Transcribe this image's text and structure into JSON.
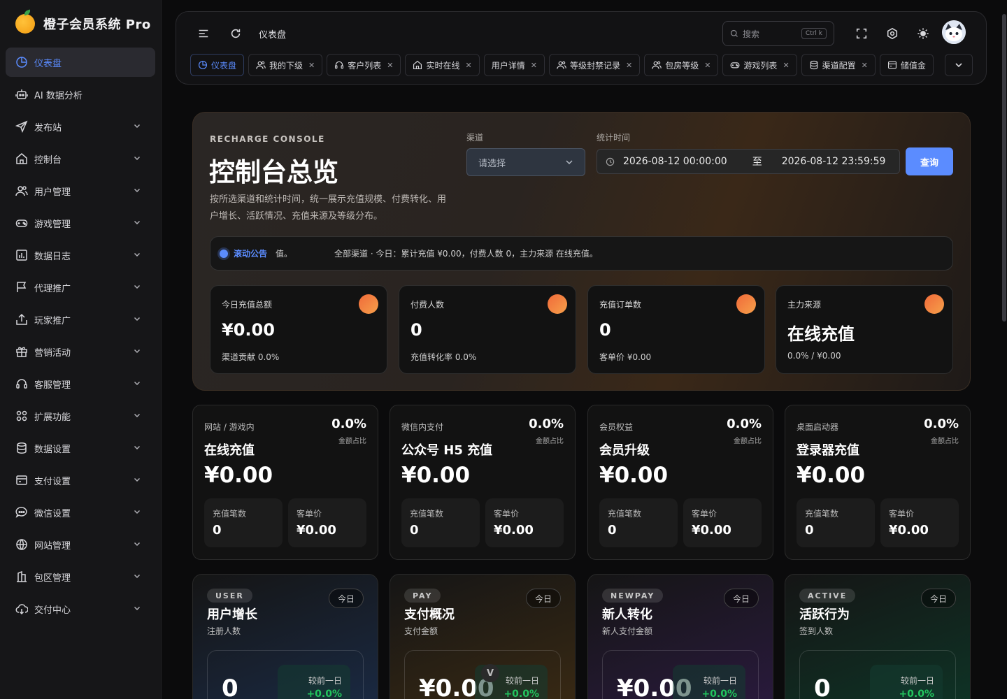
{
  "brand": {
    "name": "橙子会员系统 Pro"
  },
  "sidebar": {
    "items": [
      {
        "label": "仪表盘",
        "icon": "dashboard-icon",
        "active": true
      },
      {
        "label": "AI 数据分析",
        "icon": "robot-icon"
      },
      {
        "label": "发布站",
        "icon": "send-icon",
        "expandable": true
      },
      {
        "label": "控制台",
        "icon": "home-icon",
        "expandable": true
      },
      {
        "label": "用户管理",
        "icon": "users-icon",
        "expandable": true
      },
      {
        "label": "游戏管理",
        "icon": "gamepad-icon",
        "expandable": true
      },
      {
        "label": "数据日志",
        "icon": "chart-log-icon",
        "expandable": true
      },
      {
        "label": "代理推广",
        "icon": "flag-icon",
        "expandable": true
      },
      {
        "label": "玩家推广",
        "icon": "share-icon",
        "expandable": true
      },
      {
        "label": "营销活动",
        "icon": "gift-icon",
        "expandable": true
      },
      {
        "label": "客服管理",
        "icon": "headset-icon",
        "expandable": true
      },
      {
        "label": "扩展功能",
        "icon": "apps-icon",
        "expandable": true
      },
      {
        "label": "数据设置",
        "icon": "database-icon",
        "expandable": true
      },
      {
        "label": "支付设置",
        "icon": "wallet-icon",
        "expandable": true
      },
      {
        "label": "微信设置",
        "icon": "chat-icon",
        "expandable": true
      },
      {
        "label": "网站管理",
        "icon": "globe-icon",
        "expandable": true
      },
      {
        "label": "包区管理",
        "icon": "building-icon",
        "expandable": true
      },
      {
        "label": "交付中心",
        "icon": "cloud-icon",
        "expandable": true
      }
    ]
  },
  "header": {
    "title": "仪表盘",
    "search": {
      "placeholder": "搜索",
      "shortcut": "Ctrl k"
    }
  },
  "tabs": [
    {
      "label": "仪表盘",
      "icon": "dashboard-icon",
      "active": true,
      "closable": false
    },
    {
      "label": "我的下级",
      "icon": "users-icon",
      "closable": true
    },
    {
      "label": "客户列表",
      "icon": "headset-icon",
      "closable": true
    },
    {
      "label": "实时在线",
      "icon": "home-icon",
      "closable": true
    },
    {
      "label": "用户详情",
      "icon": "",
      "closable": true
    },
    {
      "label": "等级封禁记录",
      "icon": "users-icon",
      "closable": true
    },
    {
      "label": "包房等级",
      "icon": "users-icon",
      "closable": true
    },
    {
      "label": "游戏列表",
      "icon": "gamepad-icon",
      "closable": true
    },
    {
      "label": "渠道配置",
      "icon": "database-icon",
      "closable": true
    },
    {
      "label": "储值金",
      "icon": "wallet-icon",
      "closable": false
    }
  ],
  "hero": {
    "eyebrow": "RECHARGE CONSOLE",
    "title": "控制台总览",
    "description": "按所选渠道和统计时间，统一展示充值规模、付费转化、用户增长、活跃情况、充值来源及等级分布。",
    "channel_label": "渠道",
    "channel_placeholder": "请选择",
    "time_label": "统计时间",
    "date_start": "2026-08-12 00:00:00",
    "date_sep": "至",
    "date_end": "2026-08-12 23:59:59",
    "query_label": "查询",
    "notice_tag": "滚动公告",
    "notice_prefix": "值。",
    "notice_text": "全部渠道 · 今日：累计充值 ¥0.00，付费人数 0，主力来源 在线充值。"
  },
  "stats": [
    {
      "label": "今日充值总额",
      "value": "¥0.00",
      "sub": "渠道贡献 0.0%"
    },
    {
      "label": "付费人数",
      "value": "0",
      "sub": "充值转化率 0.0%"
    },
    {
      "label": "充值订单数",
      "value": "0",
      "sub": "客单价 ¥0.00"
    },
    {
      "label": "主力来源",
      "value": "在线充值",
      "sub": "0.0% / ¥0.00"
    }
  ],
  "sources": [
    {
      "kicker": "网站 / 游戏内",
      "title": "在线充值",
      "pct": "0.0%",
      "pct_label": "金额占比",
      "amount": "¥0.00",
      "count_label": "充值笔数",
      "count": "0",
      "avg_label": "客单价",
      "avg": "¥0.00"
    },
    {
      "kicker": "微信内支付",
      "title": "公众号 H5 充值",
      "pct": "0.0%",
      "pct_label": "金额占比",
      "amount": "¥0.00",
      "count_label": "充值笔数",
      "count": "0",
      "avg_label": "客单价",
      "avg": "¥0.00"
    },
    {
      "kicker": "会员权益",
      "title": "会员升级",
      "pct": "0.0%",
      "pct_label": "金额占比",
      "amount": "¥0.00",
      "count_label": "充值笔数",
      "count": "0",
      "avg_label": "客单价",
      "avg": "¥0.00"
    },
    {
      "kicker": "桌面启动器",
      "title": "登录器充值",
      "pct": "0.0%",
      "pct_label": "金额占比",
      "amount": "¥0.00",
      "count_label": "充值笔数",
      "count": "0",
      "avg_label": "客单价",
      "avg": "¥0.00"
    }
  ],
  "metrics": [
    {
      "tag": "USER",
      "today": "今日",
      "title": "用户增长",
      "sub": "注册人数",
      "value": "0",
      "cmp_label": "较前一日",
      "cmp_value": "+0.0%",
      "bg": "#1a2a44"
    },
    {
      "tag": "PAY",
      "today": "今日",
      "title": "支付概况",
      "sub": "支付金额",
      "value": "¥0.00",
      "cmp_label": "较前一日",
      "cmp_value": "+0.0%",
      "bg": "#3a2a14",
      "badge": "V"
    },
    {
      "tag": "NEWPAY",
      "today": "今日",
      "title": "新人转化",
      "sub": "新人支付金额",
      "value": "¥0.00",
      "cmp_label": "较前一日",
      "cmp_value": "+0.0%",
      "bg": "#2a1a3e"
    },
    {
      "tag": "ACTIVE",
      "today": "今日",
      "title": "活跃行为",
      "sub": "签到人数",
      "value": "0",
      "cmp_label": "较前一日",
      "cmp_value": "+0.0%",
      "bg": "#0e3426"
    }
  ],
  "colors": {
    "accent": "#5b8cff",
    "positive": "#22c55e",
    "orange": "#f06a3a"
  }
}
